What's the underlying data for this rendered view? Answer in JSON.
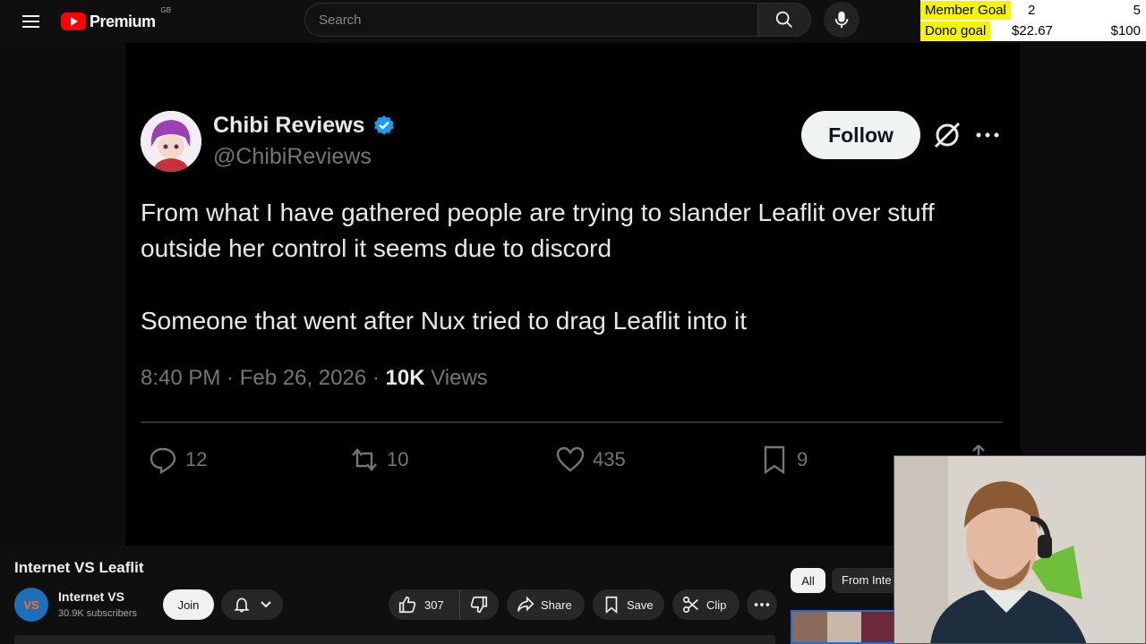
{
  "header": {
    "brand": "Premium",
    "region": "GB",
    "search_placeholder": "Search"
  },
  "goal_overlay": {
    "member_goal": {
      "label": "Member Goal",
      "current": "2",
      "target": "5"
    },
    "dono_goal": {
      "label": "Dono goal",
      "current": "$22.67",
      "target": "$100"
    }
  },
  "tweet": {
    "display_name": "Chibi Reviews",
    "handle": "@ChibiReviews",
    "follow_label": "Follow",
    "paragraphs": [
      "From what I have gathered people are trying to slander Leaflit over stuff outside her control it seems due to discord",
      "Someone that went after Nux tried to drag Leaflit into it"
    ],
    "time": "8:40 PM",
    "date": "Feb 26, 2026",
    "views_count": "10K",
    "views_label": "Views",
    "replies": "12",
    "reposts": "10",
    "likes": "435",
    "bookmarks": "9"
  },
  "video_info": {
    "title": "Internet VS Leaflit",
    "channel_name": "Internet VS",
    "channel_avatar_text": "VS",
    "subscribers": "30.9K subscribers",
    "join_label": "Join",
    "like_count": "307",
    "share_label": "Share",
    "save_label": "Save",
    "clip_label": "Clip"
  },
  "recommendations": {
    "chips": [
      "All",
      "From Inte"
    ]
  },
  "colors": {
    "youtube_red": "#ff0000",
    "verified_blue": "#1d9bf0",
    "goal_highlight": "#f5f500"
  }
}
